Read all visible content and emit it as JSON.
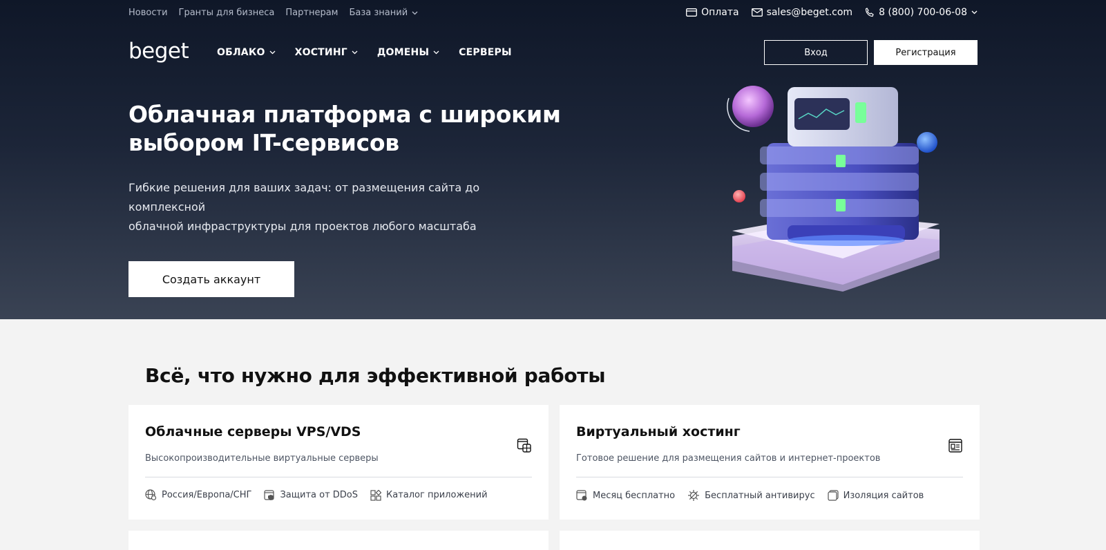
{
  "topbar": {
    "links": [
      "Новости",
      "Гранты для бизнеса",
      "Партнерам",
      "База знаний"
    ],
    "payment": "Оплата",
    "email": "sales@beget.com",
    "phone": "8 (800) 700-06-08"
  },
  "nav": {
    "logo": "beget",
    "menu": [
      "ОБЛАКО",
      "ХОСТИНГ",
      "ДОМЕНЫ",
      "СЕРВЕРЫ"
    ],
    "login": "Вход",
    "register": "Регистрация"
  },
  "hero": {
    "title_line1": "Облачная платформа с широким",
    "title_line2": "выбором IT-сервисов",
    "subtitle_line1": "Гибкие решения для ваших задач: от размещения сайта до комплексной",
    "subtitle_line2": "облачной инфраструктуры для проектов любого масштаба",
    "cta": "Создать аккаунт"
  },
  "section": {
    "title": "Всё, что нужно для эффективной работы"
  },
  "cards": [
    {
      "title": "Облачные серверы VPS/VDS",
      "desc": "Высокопроизводительные виртуальные серверы",
      "features": [
        "Россия/Европа/СНГ",
        "Защита от DDoS",
        "Каталог приложений"
      ]
    },
    {
      "title": "Виртуальный хостинг",
      "desc": "Готовое решение для размещения сайтов и интернет-проектов",
      "features": [
        "Месяц бесплатно",
        "Бесплатный антивирус",
        "Изоляция сайтов"
      ]
    }
  ],
  "colors": {
    "hero_top": "#0f1728",
    "hero_bottom": "#3a4354",
    "page_bg": "#f3f3f3",
    "accent_purple": "#b884e6"
  }
}
